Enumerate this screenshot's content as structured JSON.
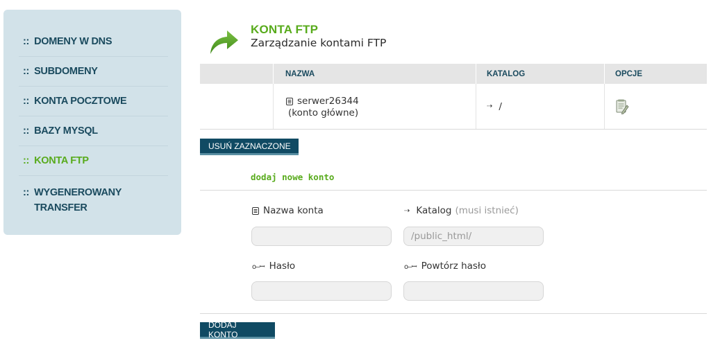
{
  "sidebar": {
    "prefix": "::",
    "items": [
      {
        "label": "DOMENY W DNS"
      },
      {
        "label": "SUBDOMENY"
      },
      {
        "label": "KONTA POCZTOWE"
      },
      {
        "label": "BAZY MYSQL"
      },
      {
        "label": "KONTA FTP"
      },
      {
        "label": "WYGENEROWANY TRANSFER"
      }
    ],
    "active_index": 4
  },
  "header": {
    "title": "KONTA FTP",
    "subtitle": "Zarządzanie kontami FTP"
  },
  "table": {
    "columns": [
      "NAZWA",
      "KATALOG",
      "OPCJE"
    ],
    "rows": [
      {
        "name": "serwer26344",
        "note": "(konto główne)",
        "dir": "/"
      }
    ]
  },
  "buttons": {
    "delete_selected": "USUŃ ZAZNACZONE",
    "add_account": "DODAJ KONTO"
  },
  "add_form": {
    "title": "dodaj nowe konto",
    "name_label": "Nazwa konta",
    "dir_label": "Katalog",
    "dir_hint": "(musi istnieć)",
    "dir_placeholder": "/public_html/",
    "password_label": "Hasło",
    "password_repeat_label": "Powtórz hasło"
  },
  "colors": {
    "accent_green": "#58ab1c",
    "dark_blue": "#104a63",
    "sidebar_bg": "#d2e2e9"
  }
}
